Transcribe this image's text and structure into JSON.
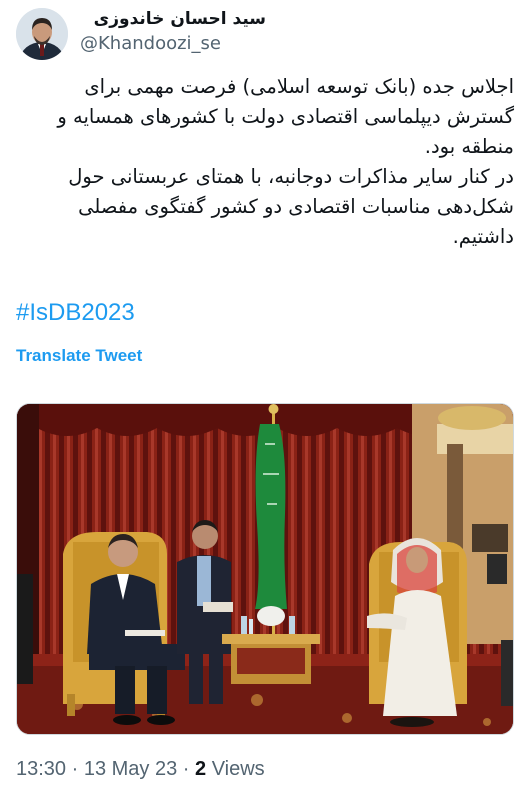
{
  "author": {
    "display_name": "سید احسان خاندوزی",
    "handle": "@Khandoozi_se",
    "avatar_icon": "profile-photo"
  },
  "tweet": {
    "paragraph_1": "اجلاس جده (بانک توسعه اسلامی) فرصت مهمی برای گسترش دیپلماسی اقتصادی دولت با کشورهای همسایه و منطقه بود.",
    "paragraph_2": "در کنار سایر مذاکرات دوجانبه، با همتای عربستانی حول شکل‌دهی مناسبات اقتصادی دو کشور گفتگوی مفصلی داشتیم.",
    "hashtag": "#IsDB2023",
    "translate_label": "Translate Tweet",
    "media_icon": "meeting-photo"
  },
  "meta": {
    "time": "13:30",
    "separator_1": " · ",
    "date": "13 May 23",
    "separator_2": " · ",
    "views_count": "2",
    "views_label": " Views"
  },
  "colors": {
    "link": "#1d9bf0",
    "secondary_text": "#536471",
    "primary_text": "#0f1419"
  }
}
